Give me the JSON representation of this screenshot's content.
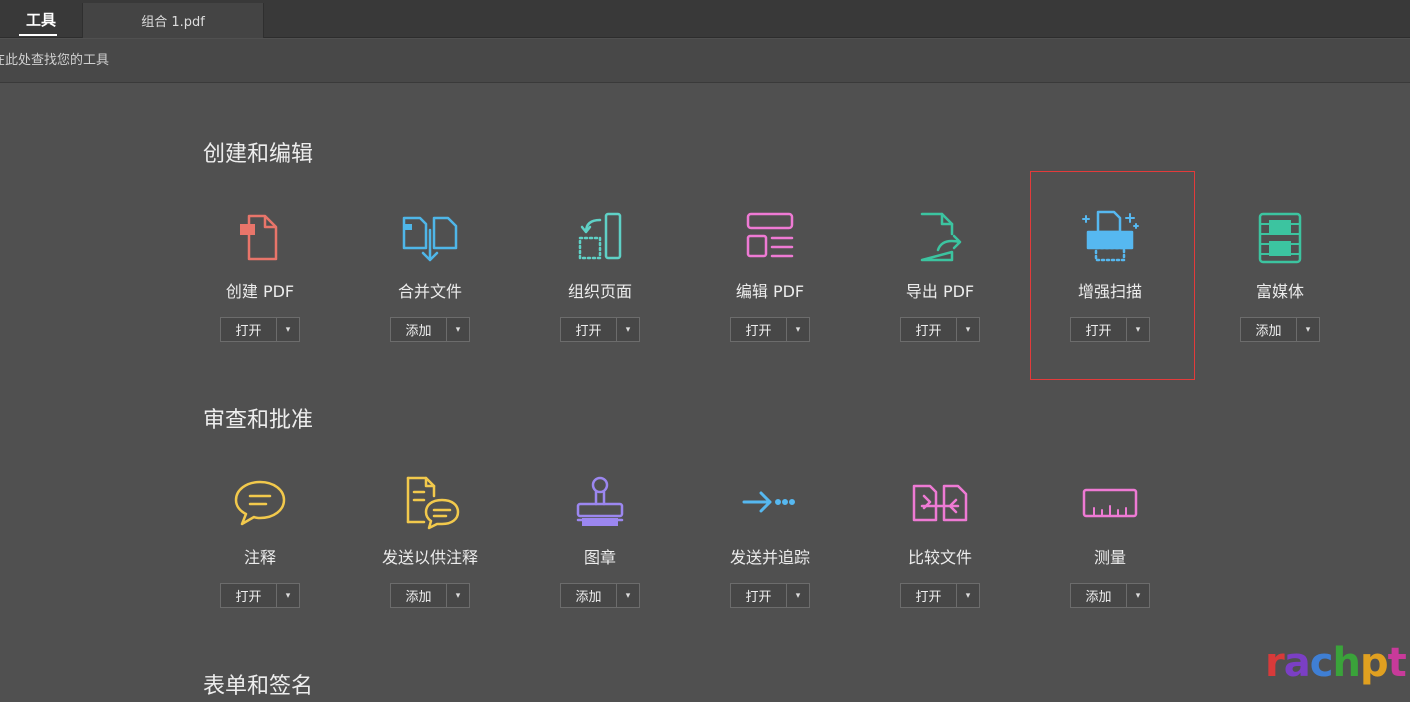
{
  "tabs": {
    "tools": "工具",
    "document": "组合 1.pdf"
  },
  "search": {
    "placeholder": "在此处查找您的工具"
  },
  "sections": [
    {
      "title": "创建和编辑",
      "tools": [
        {
          "label": "创建 PDF",
          "action": "打开",
          "icon": "create-pdf-icon",
          "color": "#e8756a"
        },
        {
          "label": "合并文件",
          "action": "添加",
          "icon": "combine-files-icon",
          "color": "#4fb6e8"
        },
        {
          "label": "组织页面",
          "action": "打开",
          "icon": "organize-pages-icon",
          "color": "#5fd1c6"
        },
        {
          "label": "编辑 PDF",
          "action": "打开",
          "icon": "edit-pdf-icon",
          "color": "#ee7ad4"
        },
        {
          "label": "导出 PDF",
          "action": "打开",
          "icon": "export-pdf-icon",
          "color": "#3cc4a0"
        },
        {
          "label": "增强扫描",
          "action": "打开",
          "icon": "enhance-scan-icon",
          "color": "#56b8f0"
        },
        {
          "label": "富媒体",
          "action": "添加",
          "icon": "rich-media-icon",
          "color": "#3cc4a0"
        }
      ]
    },
    {
      "title": "审查和批准",
      "tools": [
        {
          "label": "注释",
          "action": "打开",
          "icon": "comment-icon",
          "color": "#f2c94c"
        },
        {
          "label": "发送以供注释",
          "action": "添加",
          "icon": "send-for-comments-icon",
          "color": "#f2c94c"
        },
        {
          "label": "图章",
          "action": "添加",
          "icon": "stamp-icon",
          "color": "#9c87f0"
        },
        {
          "label": "发送并追踪",
          "action": "打开",
          "icon": "send-and-track-icon",
          "color": "#56b8f0"
        },
        {
          "label": "比较文件",
          "action": "打开",
          "icon": "compare-files-icon",
          "color": "#ee7ad4"
        },
        {
          "label": "测量",
          "action": "添加",
          "icon": "measure-icon",
          "color": "#ee7ad4"
        }
      ]
    },
    {
      "title": "表单和签名",
      "tools": []
    }
  ],
  "dropdown_glyph": "▾",
  "highlight_color": "#e23b3b",
  "watermark": {
    "text": "rachpt",
    "colors": [
      "#d83a3a",
      "#7b3fc4",
      "#3f7fd4",
      "#3aa33a",
      "#e0a020",
      "#c83a9a"
    ]
  }
}
